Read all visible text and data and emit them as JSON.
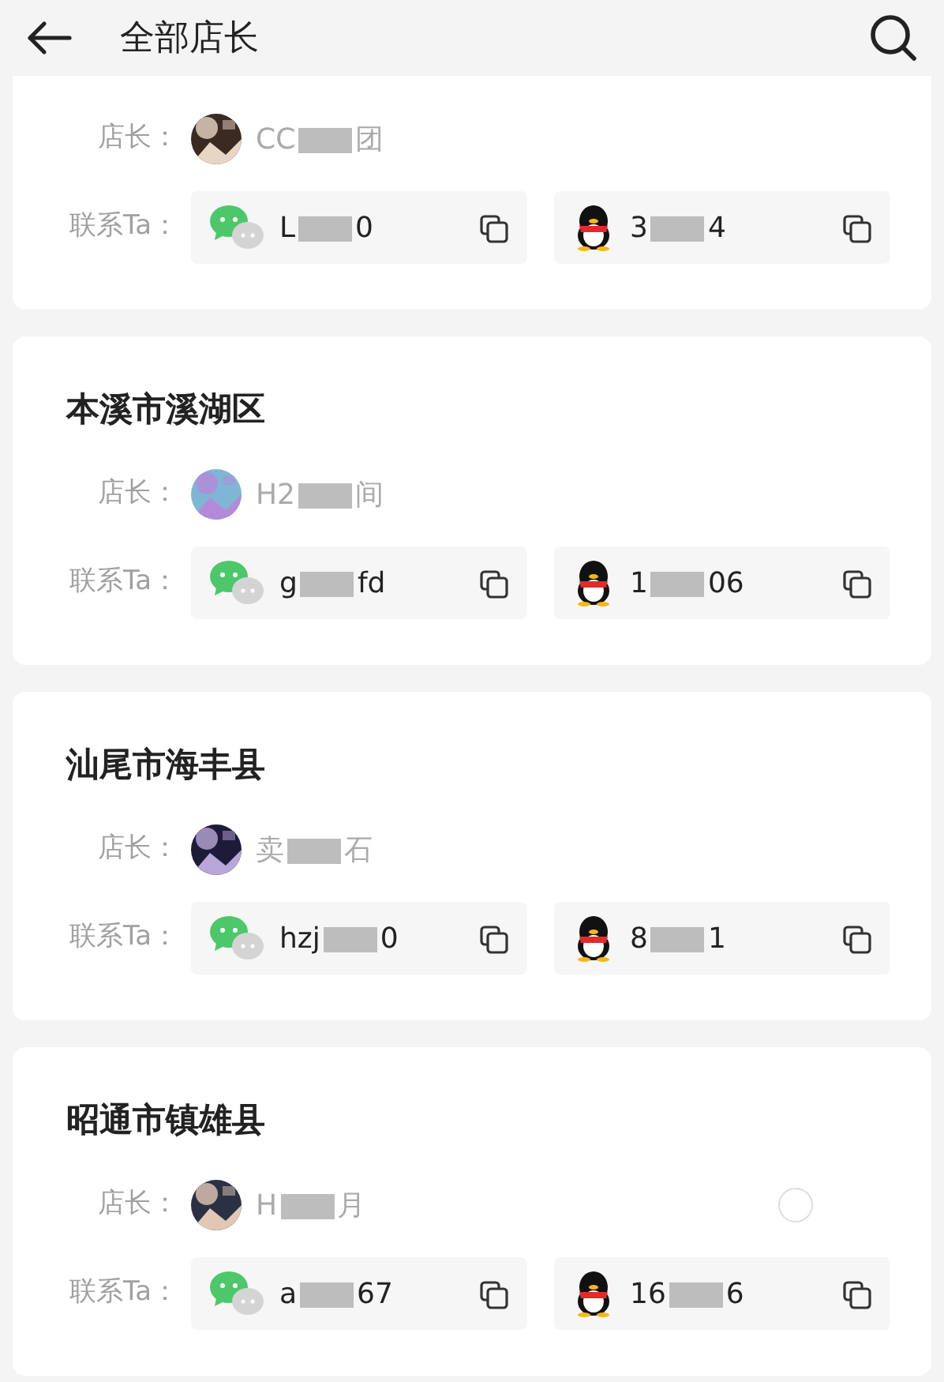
{
  "header": {
    "title": "全部店长"
  },
  "cards": [
    {
      "owner_label": "店长：",
      "owner_parts": [
        "CC",
        "团"
      ],
      "contact_label": "联系Ta：",
      "wechat_parts": [
        "L",
        "0"
      ],
      "qq_parts": [
        "3",
        "4"
      ]
    },
    {
      "title": "本溪市溪湖区",
      "owner_label": "店长：",
      "owner_parts": [
        "H2",
        "间"
      ],
      "contact_label": "联系Ta：",
      "wechat_parts": [
        "g",
        "fd"
      ],
      "qq_parts": [
        "1",
        "06"
      ]
    },
    {
      "title": "汕尾市海丰县",
      "owner_label": "店长：",
      "owner_parts": [
        "卖",
        "石"
      ],
      "contact_label": "联系Ta：",
      "wechat_parts": [
        "hzj",
        "0"
      ],
      "qq_parts": [
        "8",
        "1"
      ]
    },
    {
      "title": "昭通市镇雄县",
      "owner_label": "店长：",
      "owner_parts": [
        "H",
        "月"
      ],
      "contact_label": "联系Ta：",
      "wechat_parts": [
        "a",
        "67"
      ],
      "qq_parts": [
        "16",
        "6"
      ]
    }
  ]
}
